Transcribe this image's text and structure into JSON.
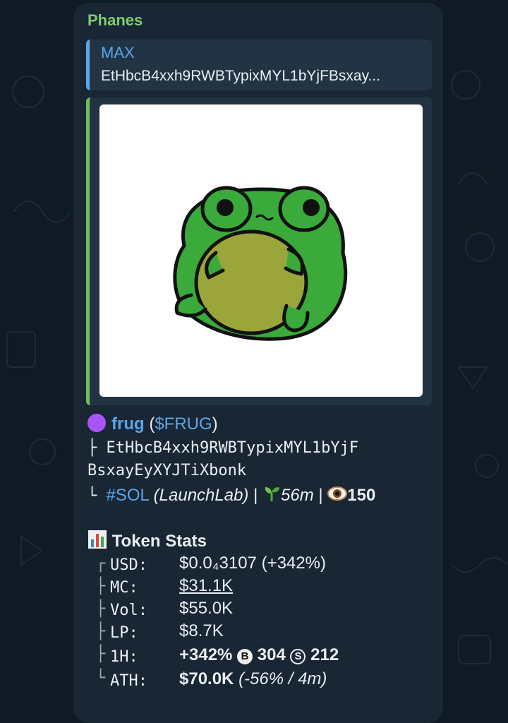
{
  "message": {
    "sender": "Phanes",
    "reply": {
      "name": "MAX",
      "text": "EtHbcB4xxh9RWBTypixMYL1bYjFBsxay..."
    },
    "token": {
      "name": "frug",
      "ticker_open": " (",
      "ticker": "$FRUG",
      "ticker_close": ")",
      "address_line1": "EtHbcB4xxh9RWBTypixMYL1bYjF",
      "address_line2": "BsxayEyXYJTiXbonk",
      "chain": "#SOL",
      "launchpad": "(LaunchLab)",
      "sep": "|",
      "age": "56m",
      "views": "150"
    },
    "stats": {
      "title": "Token Stats",
      "rows": [
        {
          "label": "USD:",
          "value": "$0.0₄3107 (+342%)"
        },
        {
          "label": "MC:",
          "value": "$31.1K"
        },
        {
          "label": "Vol:",
          "value": "$55.0K"
        },
        {
          "label": "LP:",
          "value": "$8.7K"
        },
        {
          "label": "1H:",
          "value": "+342%",
          "buys_icon": "B",
          "buys": "304",
          "sells_icon": "S",
          "sells": "212"
        },
        {
          "label": "ATH:",
          "value": "$70.0K",
          "ath_change": "(-56% / 4m)"
        }
      ]
    },
    "colors": {
      "sender": "#7fcf6b",
      "link": "#5aa5e8",
      "bubble": "#192734",
      "background": "#0f1a24"
    },
    "icons": {
      "token_dot": "purple-circle-icon",
      "age": "seedling-icon",
      "views": "eye-icon",
      "stats": "bar-chart-icon"
    }
  }
}
